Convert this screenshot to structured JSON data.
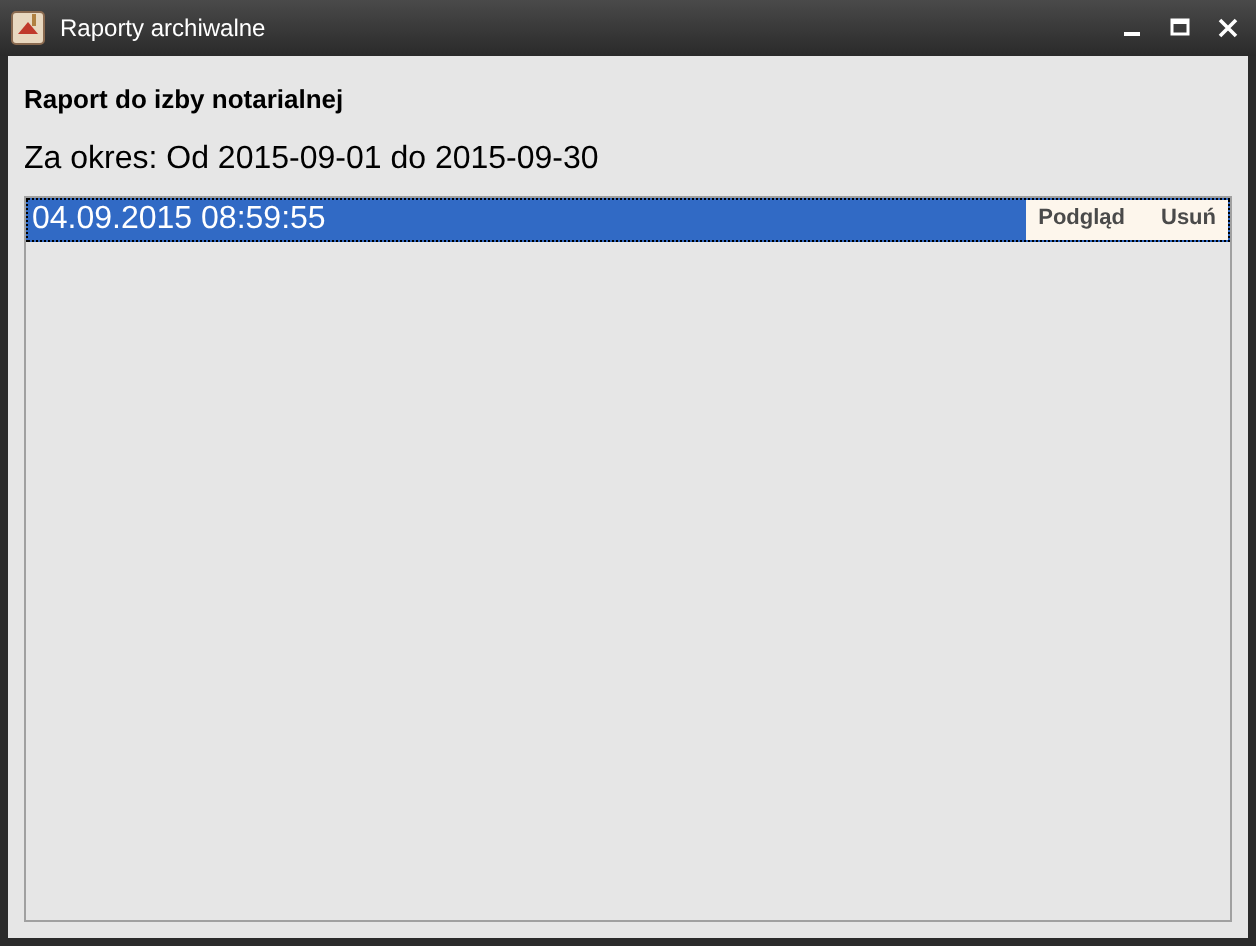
{
  "window": {
    "title": "Raporty archiwalne"
  },
  "heading": "Raport do izby notarialnej",
  "period": "Za okres: Od 2015-09-01 do 2015-09-30",
  "reports": [
    {
      "date": "04.09.2015 08:59:55",
      "selected": true,
      "actions": [
        "Podgląd",
        "Usuń"
      ]
    }
  ]
}
